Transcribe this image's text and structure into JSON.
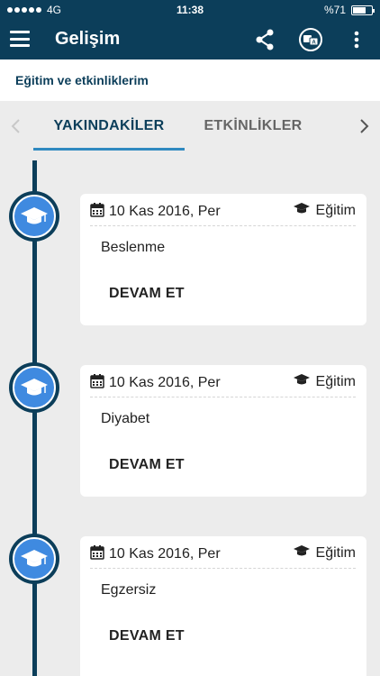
{
  "status_bar": {
    "network": "4G",
    "time": "11:38",
    "battery": "%71",
    "battery_level": 0.71
  },
  "app_bar": {
    "title": "Gelişim",
    "icons": [
      "menu-icon",
      "share-icon",
      "translate-icon",
      "more-vert-icon"
    ]
  },
  "subheader": {
    "title": "Eğitim ve etkinliklerim"
  },
  "tabs": {
    "items": [
      {
        "label": "YAKINDAKİLER",
        "active": true
      },
      {
        "label": "ETKİNLİKLER",
        "active": false
      }
    ],
    "prev_icon": "chevron-left-icon",
    "next_icon": "chevron-right-icon"
  },
  "colors": {
    "primary": "#0c3e5a",
    "accent": "#3f8ae0",
    "tab_underline": "#2f89c0",
    "background": "#ececec"
  },
  "timeline": {
    "items": [
      {
        "date": "10 Kas 2016, Per",
        "type": "Eğitim",
        "title": "Beslenme",
        "action": "DEVAM ET"
      },
      {
        "date": "10 Kas 2016, Per",
        "type": "Eğitim",
        "title": "Diyabet",
        "action": "DEVAM ET"
      },
      {
        "date": "10 Kas 2016, Per",
        "type": "Eğitim",
        "title": "Egzersiz",
        "action": "DEVAM ET"
      }
    ]
  }
}
